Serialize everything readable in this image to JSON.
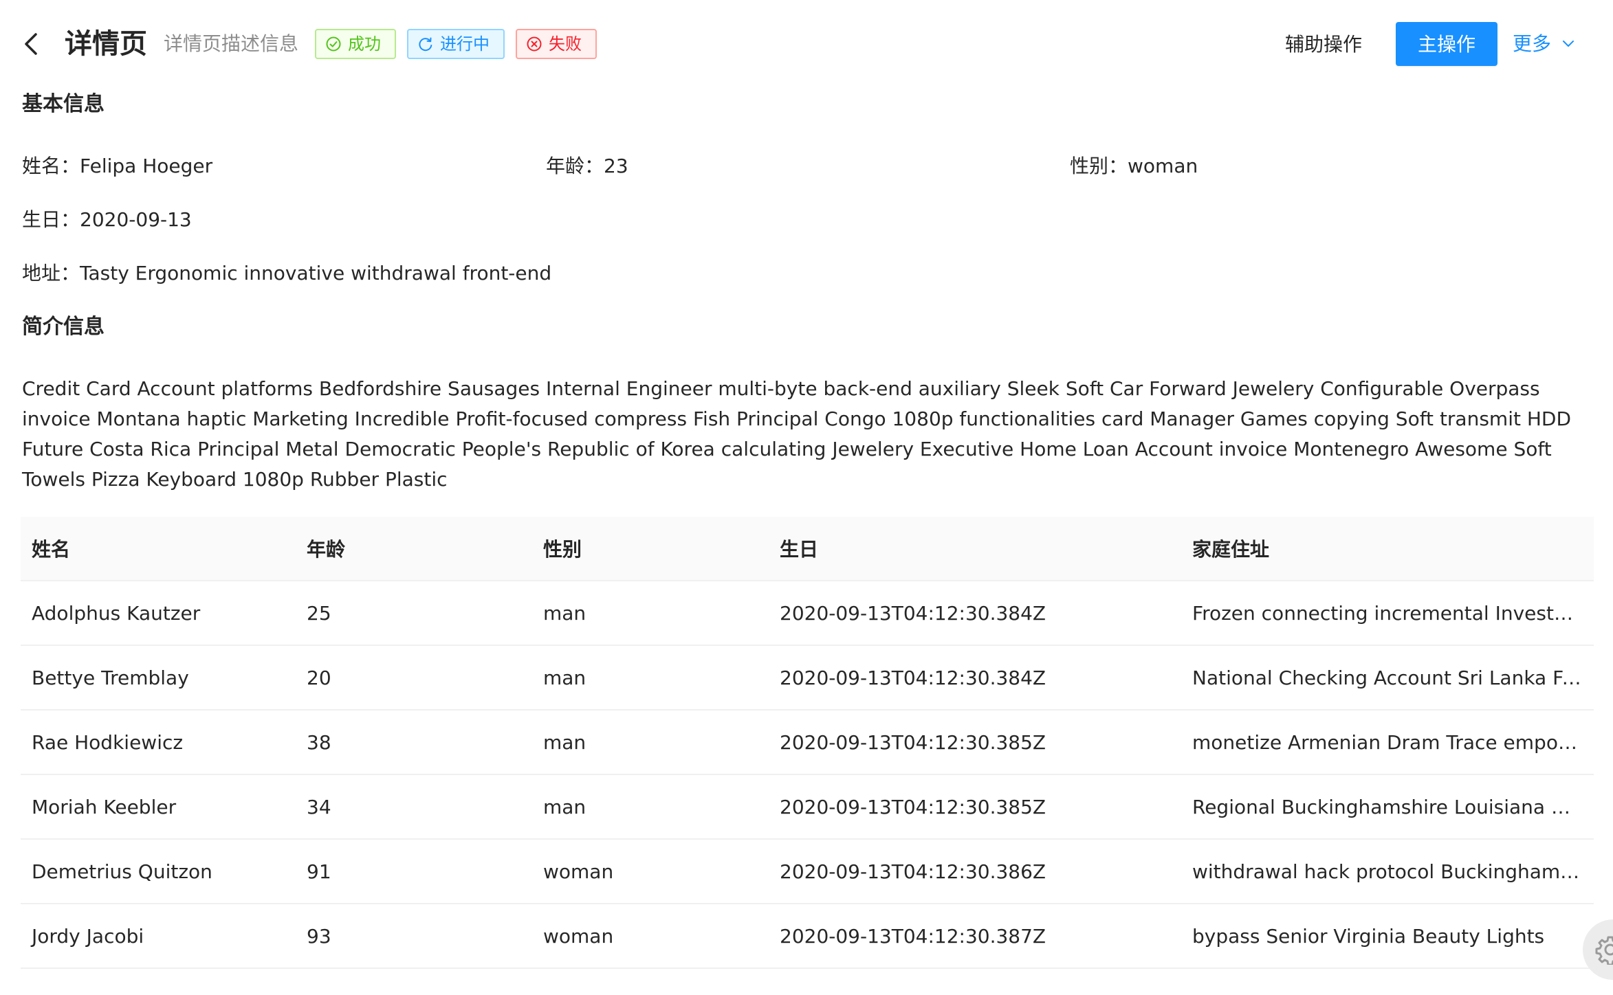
{
  "header": {
    "title": "详情页",
    "subtitle": "详情页描述信息",
    "tags": [
      {
        "label": "成功",
        "status": "success",
        "icon": "check-circle-icon"
      },
      {
        "label": "进行中",
        "status": "processing",
        "icon": "sync-icon"
      },
      {
        "label": "失败",
        "status": "error",
        "icon": "close-circle-icon"
      }
    ],
    "secondary_action": "辅助操作",
    "primary_action": "主操作",
    "more_action": "更多"
  },
  "basic_info": {
    "title": "基本信息",
    "items": [
      {
        "label": "姓名：",
        "value": "Felipa Hoeger"
      },
      {
        "label": "年龄：",
        "value": "23"
      },
      {
        "label": "性别：",
        "value": "woman"
      },
      {
        "label": "生日：",
        "value": "2020-09-13"
      },
      {
        "label": "地址：",
        "value": "Tasty Ergonomic innovative withdrawal front-end"
      }
    ]
  },
  "intro": {
    "title": "简介信息",
    "text": "Credit Card Account platforms Bedfordshire Sausages Internal Engineer multi-byte back-end auxiliary Sleek Soft Car Forward Jewelery Configurable Overpass invoice Montana haptic Marketing Incredible Profit-focused compress Fish Principal Congo 1080p functionalities card Manager Games copying Soft transmit HDD Future Costa Rica Principal Metal Democratic People's Republic of Korea calculating Jewelery Executive Home Loan Account invoice Montenegro Awesome Soft Towels Pizza Keyboard 1080p Rubber Plastic"
  },
  "table": {
    "columns": [
      "姓名",
      "年龄",
      "性别",
      "生日",
      "家庭住址"
    ],
    "rows": [
      [
        "Adolphus Kautzer",
        "25",
        "man",
        "2020-09-13T04:12:30.384Z",
        "Frozen connecting incremental Investmen..."
      ],
      [
        "Bettye Tremblay",
        "20",
        "man",
        "2020-09-13T04:12:30.384Z",
        "National Checking Account Sri Lanka Fant..."
      ],
      [
        "Rae Hodkiewicz",
        "38",
        "man",
        "2020-09-13T04:12:30.385Z",
        "monetize Armenian Dram Trace empoweri..."
      ],
      [
        "Moriah Keebler",
        "34",
        "man",
        "2020-09-13T04:12:30.385Z",
        "Regional Buckinghamshire Louisiana Barb..."
      ],
      [
        "Demetrius Quitzon",
        "91",
        "woman",
        "2020-09-13T04:12:30.386Z",
        "withdrawal hack protocol Buckinghamshir..."
      ],
      [
        "Jordy Jacobi",
        "93",
        "woman",
        "2020-09-13T04:12:30.387Z",
        "bypass Senior Virginia Beauty Lights"
      ]
    ]
  },
  "colors": {
    "primary": "#1890ff",
    "success": "#52c41a",
    "error": "#f5222d",
    "table_header_bg": "#fafafa"
  },
  "icons": {
    "back": "arrow-left-icon",
    "more": "chevron-down-icon",
    "settings": "gear-icon"
  }
}
